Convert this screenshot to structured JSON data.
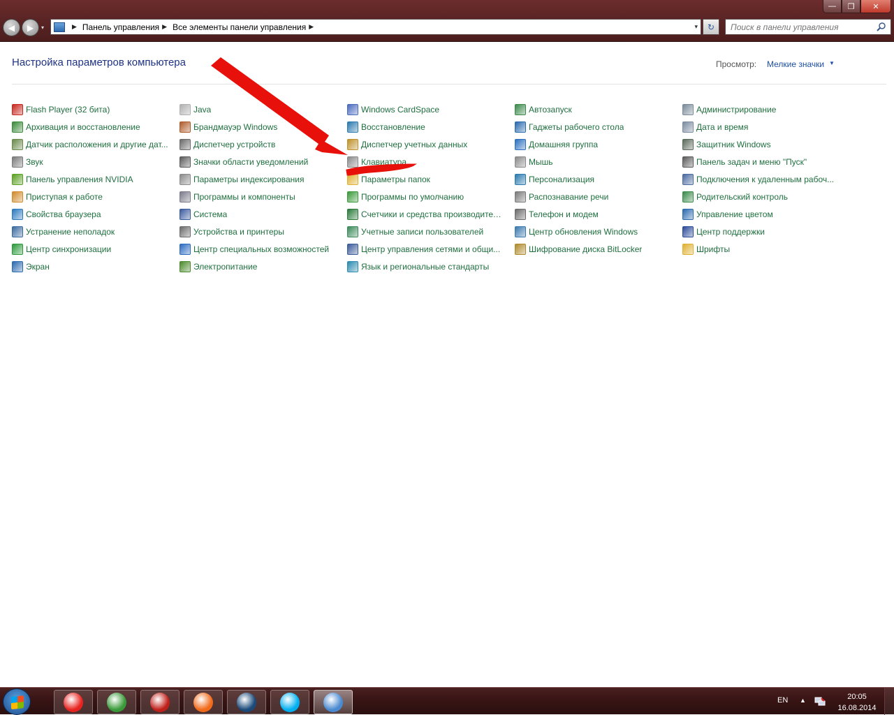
{
  "window": {
    "min_glyph": "—",
    "max_glyph": "❐",
    "close_glyph": "✕"
  },
  "nav": {
    "back_glyph": "◀",
    "forward_glyph": "▶",
    "recent_glyph": "▾"
  },
  "address": {
    "crumbs": [
      "Панель управления",
      "Все элементы панели управления"
    ],
    "sep": "▶",
    "drop_glyph": "▾",
    "refresh_glyph": "↻"
  },
  "search": {
    "placeholder": "Поиск в панели управления"
  },
  "page": {
    "title": "Настройка параметров компьютера",
    "view_label": "Просмотр:",
    "view_value": "Мелкие значки",
    "view_caret": "▼"
  },
  "columns": [
    [
      {
        "label": "Flash Player (32 бита)",
        "icon": "flash-icon",
        "color": "#c8261e"
      },
      {
        "label": "Архивация и восстановление",
        "icon": "backup-icon",
        "color": "#3a8a3a"
      },
      {
        "label": "Датчик расположения и другие дат...",
        "icon": "sensor-icon",
        "color": "#6a8a4a"
      },
      {
        "label": "Звук",
        "icon": "speaker-icon",
        "color": "#7a7a7a"
      },
      {
        "label": "Панель управления NVIDIA",
        "icon": "nvidia-icon",
        "color": "#5aa021"
      },
      {
        "label": "Приступая к работе",
        "icon": "getting-started-icon",
        "color": "#d08a2a"
      },
      {
        "label": "Свойства браузера",
        "icon": "internet-options-icon",
        "color": "#2a7ac0"
      },
      {
        "label": "Устранение неполадок",
        "icon": "troubleshoot-icon",
        "color": "#3a6aa0"
      },
      {
        "label": "Центр синхронизации",
        "icon": "sync-icon",
        "color": "#2a9a3a"
      },
      {
        "label": "Экран",
        "icon": "display-icon",
        "color": "#2a6ab0"
      }
    ],
    [
      {
        "label": "Java",
        "icon": "java-icon",
        "color": "#b0b0b0"
      },
      {
        "label": "Брандмауэр Windows",
        "icon": "firewall-icon",
        "color": "#b05a2a"
      },
      {
        "label": "Диспетчер устройств",
        "icon": "device-manager-icon",
        "color": "#6a6a6a"
      },
      {
        "label": "Значки области уведомлений",
        "icon": "notification-icon",
        "color": "#5a5a5a"
      },
      {
        "label": "Параметры индексирования",
        "icon": "indexing-icon",
        "color": "#8a8a8a"
      },
      {
        "label": "Программы и компоненты",
        "icon": "programs-icon",
        "color": "#7a7a8a"
      },
      {
        "label": "Система",
        "icon": "system-icon",
        "color": "#3a5aa0"
      },
      {
        "label": "Устройства и принтеры",
        "icon": "printer-icon",
        "color": "#6a6a6a"
      },
      {
        "label": "Центр специальных возможностей",
        "icon": "accessibility-icon",
        "color": "#2a6ac0"
      },
      {
        "label": "Электропитание",
        "icon": "power-icon",
        "color": "#4a8a2a"
      }
    ],
    [
      {
        "label": "Windows CardSpace",
        "icon": "cardspace-icon",
        "color": "#4a6ac0"
      },
      {
        "label": "Восстановление",
        "icon": "recovery-icon",
        "color": "#2a7ab0"
      },
      {
        "label": "Диспетчер учетных данных",
        "icon": "credential-icon",
        "color": "#c0902a"
      },
      {
        "label": "Клавиатура",
        "icon": "keyboard-icon",
        "color": "#8a8a8a"
      },
      {
        "label": "Параметры папок",
        "icon": "folder-options-icon",
        "color": "#e0b030"
      },
      {
        "label": "Программы по умолчанию",
        "icon": "default-programs-icon",
        "color": "#3a9a3a"
      },
      {
        "label": "Счетчики и средства производител...",
        "icon": "performance-icon",
        "color": "#2a7a3a"
      },
      {
        "label": "Учетные записи пользователей",
        "icon": "users-icon",
        "color": "#3a8a5a"
      },
      {
        "label": "Центр управления сетями и общи...",
        "icon": "network-icon",
        "color": "#3a5a9a"
      },
      {
        "label": "Язык и региональные стандарты",
        "icon": "region-icon",
        "color": "#2a8ab0"
      }
    ],
    [
      {
        "label": "Автозапуск",
        "icon": "autoplay-icon",
        "color": "#3a8a4a"
      },
      {
        "label": "Гаджеты рабочего стола",
        "icon": "gadgets-icon",
        "color": "#2a6ab0"
      },
      {
        "label": "Домашняя группа",
        "icon": "homegroup-icon",
        "color": "#2a70c0"
      },
      {
        "label": "Мышь",
        "icon": "mouse-icon",
        "color": "#8a8a8a"
      },
      {
        "label": "Персонализация",
        "icon": "personalization-icon",
        "color": "#2a7ab0"
      },
      {
        "label": "Распознавание речи",
        "icon": "microphone-icon",
        "color": "#7a7a7a"
      },
      {
        "label": "Телефон и модем",
        "icon": "phone-icon",
        "color": "#6a6a6a"
      },
      {
        "label": "Центр обновления Windows",
        "icon": "update-icon",
        "color": "#3a7ab0"
      },
      {
        "label": "Шифрование диска BitLocker",
        "icon": "bitlocker-icon",
        "color": "#b08a2a"
      }
    ],
    [
      {
        "label": "Администрирование",
        "icon": "admin-tools-icon",
        "color": "#7a8a9a"
      },
      {
        "label": "Дата и время",
        "icon": "clock-icon",
        "color": "#7a8aa0"
      },
      {
        "label": "Защитник Windows",
        "icon": "defender-icon",
        "color": "#5a6a5a"
      },
      {
        "label": "Панель задач и меню \"Пуск\"",
        "icon": "taskbar-icon",
        "color": "#5a5a5a"
      },
      {
        "label": "Подключения к удаленным рабоч...",
        "icon": "remote-desktop-icon",
        "color": "#4a6aa0"
      },
      {
        "label": "Родительский контроль",
        "icon": "parental-icon",
        "color": "#3a8a4a"
      },
      {
        "label": "Управление цветом",
        "icon": "color-management-icon",
        "color": "#2a6ab0"
      },
      {
        "label": "Центр поддержки",
        "icon": "action-center-icon",
        "color": "#2a4a9a"
      },
      {
        "label": "Шрифты",
        "icon": "fonts-icon",
        "color": "#e0b030"
      }
    ]
  ],
  "taskbar": {
    "apps": [
      {
        "name": "yandex-browser-icon",
        "color": "#e8231f"
      },
      {
        "name": "chrome-icon",
        "color": "#3a9a3a"
      },
      {
        "name": "game-app-icon",
        "color": "#c0201a"
      },
      {
        "name": "origin-icon",
        "color": "#f06a1a"
      },
      {
        "name": "steam-icon",
        "color": "#1b4a7a"
      },
      {
        "name": "skype-icon",
        "color": "#00aff0"
      },
      {
        "name": "control-panel-icon",
        "color": "#4a8ad0"
      }
    ],
    "lang": "EN",
    "tray_up": "▲",
    "time": "20:05",
    "date": "16.08.2014"
  },
  "colors": {
    "link": "#1f6f3f",
    "title": "#1e3287",
    "annotation": "#e8100a"
  }
}
